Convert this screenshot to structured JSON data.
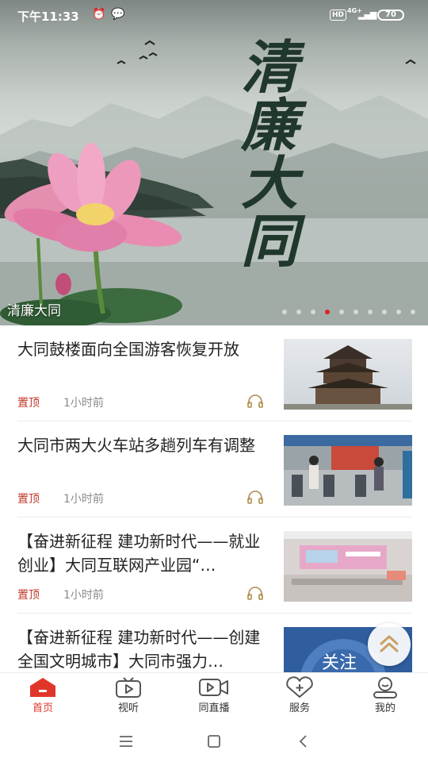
{
  "status_bar": {
    "time": "下午11:33",
    "hd": "HD",
    "network": "4G+",
    "battery": "70"
  },
  "banner": {
    "title": "清廉大同",
    "calligraphy": [
      "清",
      "廉",
      "大",
      "同"
    ],
    "dot_count": 10,
    "active_dot": 3,
    "active_dot_color": "#e02020"
  },
  "news": [
    {
      "title": "大同鼓楼面向全国游客恢复开放",
      "tag": "置顶",
      "time": "1小时前",
      "thumb_icon": "drum-tower-photo"
    },
    {
      "title": "大同市两大火车站多趟列车有调整",
      "tag": "置顶",
      "time": "1小时前",
      "thumb_icon": "train-station-gates-photo"
    },
    {
      "title": "【奋进新征程 建功新时代——就业创业】大同互联网产业园“…",
      "tag": "置顶",
      "time": "1小时前",
      "thumb_icon": "industrial-park-office-photo"
    },
    {
      "title": "【奋进新征程 建功新时代——创建全国文明城市】大同市强力…",
      "tag": "",
      "time": "",
      "thumb_icon": "follow-promo-image",
      "thumb_text": "关注"
    }
  ],
  "tabs": [
    {
      "label": "首页",
      "icon": "home-icon",
      "active": true
    },
    {
      "label": "视听",
      "icon": "tv-icon",
      "active": false
    },
    {
      "label": "同直播",
      "icon": "live-video-icon",
      "active": false
    },
    {
      "label": "服务",
      "icon": "heart-plus-icon",
      "active": false
    },
    {
      "label": "我的",
      "icon": "user-icon",
      "active": false
    }
  ],
  "colors": {
    "accent": "#e0362a",
    "tag_red": "#c0392b",
    "meta_gray": "#8a8a8a",
    "audio_gold": "#b08a4a"
  }
}
